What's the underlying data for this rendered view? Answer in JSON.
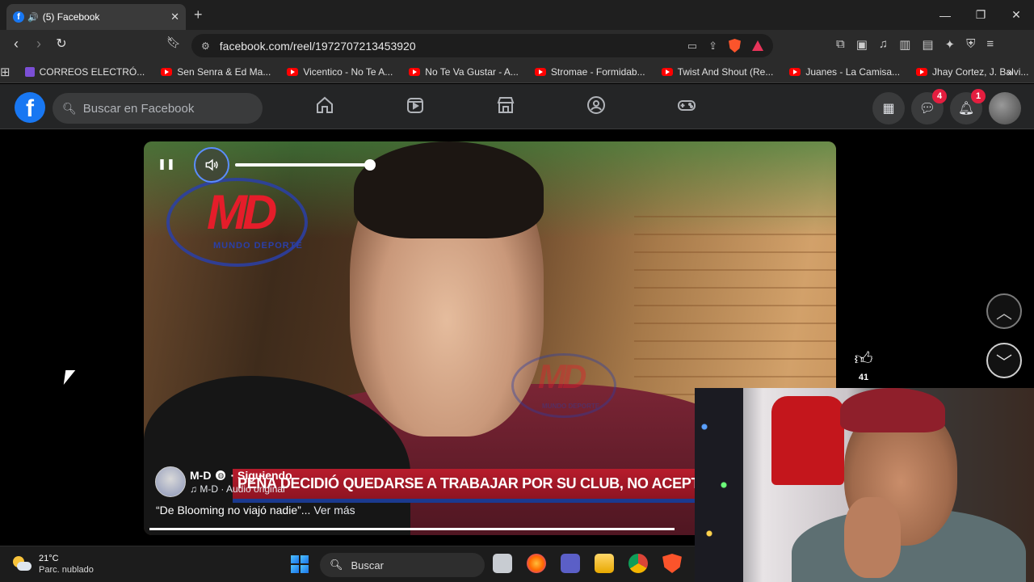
{
  "browser": {
    "tab_title": "(5) Facebook",
    "url": "facebook.com/reel/1972707213453920",
    "bookmarks": [
      {
        "label": "CORREOS ELECTRÓ...",
        "icon": "mail-icon"
      },
      {
        "label": "Sen Senra & Ed Ma...",
        "icon": "youtube-icon"
      },
      {
        "label": "Vicentico - No Te A...",
        "icon": "youtube-icon"
      },
      {
        "label": "No Te Va Gustar - A...",
        "icon": "youtube-icon"
      },
      {
        "label": "Stromae - Formidab...",
        "icon": "youtube-icon"
      },
      {
        "label": "Twist And Shout (Re...",
        "icon": "youtube-icon"
      },
      {
        "label": "Juanes - La Camisa...",
        "icon": "youtube-icon"
      },
      {
        "label": "Jhay Cortez, J. Balvi...",
        "icon": "youtube-icon"
      }
    ]
  },
  "facebook": {
    "logo": "f",
    "search_placeholder": "Buscar en Facebook",
    "messenger_badge": "4",
    "notifications_badge": "1",
    "brand_color": "#1877f2"
  },
  "reel": {
    "logo_text": "MD",
    "logo_subtext": "MUNDO DEPORTE",
    "ticker": "PEÑA DECIDIÓ QUEDARSE A TRABAJAR POR SU CLUB, NO ACEPTÓ LA INVITACIÓN DE LA FBF PA",
    "author": "M-D",
    "follow_status": "· Siguiendo",
    "audio": "M-D · Audio original",
    "caption": "“De Blooming no viajó nadie”...",
    "see_more": "Ver más",
    "likes": "41",
    "volume_fraction": 1.0,
    "progress_fraction": 1.0
  },
  "taskbar": {
    "temperature": "21°C",
    "condition": "Parc. nublado",
    "search_label": "Buscar"
  }
}
